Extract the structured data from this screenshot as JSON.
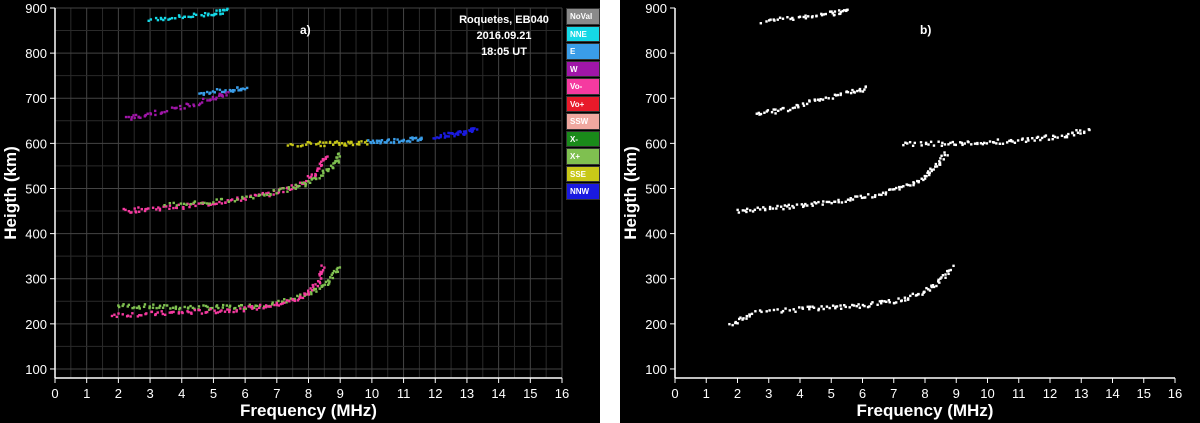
{
  "colors": {
    "background": "#000000",
    "grid": "#3a3a3a",
    "axis": "#ffffff"
  },
  "panel_a": {
    "label": "a)",
    "station": "Roquetes, EB040",
    "date": "2016.09.21",
    "time": "18:05 UT",
    "legend": [
      {
        "name": "NoVal",
        "color": "#8a8a8a"
      },
      {
        "name": "NNE",
        "color": "#15d8e6"
      },
      {
        "name": "E",
        "color": "#3a9de8"
      },
      {
        "name": "W",
        "color": "#a016a8"
      },
      {
        "name": "Vo-",
        "color": "#f53aa0"
      },
      {
        "name": "Vo+",
        "color": "#e81a2a"
      },
      {
        "name": "SSW",
        "color": "#f0a8a0"
      },
      {
        "name": "X-",
        "color": "#1a8a1a"
      },
      {
        "name": "X+",
        "color": "#7fc050"
      },
      {
        "name": "SSE",
        "color": "#c8c818"
      },
      {
        "name": "NNW",
        "color": "#1a1ae0"
      }
    ]
  },
  "panel_b": {
    "label": "b)"
  },
  "chart_data": [
    {
      "type": "scatter",
      "title": "",
      "xlabel": "Frequency (MHz)",
      "ylabel": "Heigth (km)",
      "xlim": [
        0,
        16
      ],
      "ylim": [
        80,
        900
      ],
      "xticks": [
        "0",
        "1",
        "2",
        "3",
        "4",
        "5",
        "6",
        "7",
        "8",
        "9",
        "10",
        "11",
        "12",
        "13",
        "14",
        "15",
        "16"
      ],
      "yticks": [
        "100",
        "200",
        "300",
        "400",
        "500",
        "600",
        "700",
        "800",
        "900"
      ],
      "grid": true,
      "series": [
        {
          "name": "X+",
          "color": "#7fc050",
          "points": [
            [
              2.0,
              240
            ],
            [
              3,
              238
            ],
            [
              4,
              236
            ],
            [
              5,
              236
            ],
            [
              6,
              238
            ],
            [
              7,
              245
            ],
            [
              8,
              265
            ],
            [
              8.6,
              290
            ],
            [
              9.0,
              330
            ]
          ]
        },
        {
          "name": "Vo-",
          "color": "#f53aa0",
          "points": [
            [
              1.8,
              220
            ],
            [
              3,
              222
            ],
            [
              4,
              225
            ],
            [
              5,
              228
            ],
            [
              6,
              233
            ],
            [
              7,
              242
            ],
            [
              7.8,
              258
            ],
            [
              8.3,
              290
            ],
            [
              8.5,
              330
            ]
          ]
        },
        {
          "name": "Vo-",
          "color": "#f53aa0",
          "points": [
            [
              2.2,
              450
            ],
            [
              3,
              455
            ],
            [
              4,
              460
            ],
            [
              5,
              468
            ],
            [
              6,
              478
            ],
            [
              7,
              492
            ],
            [
              7.8,
              510
            ],
            [
              8.3,
              540
            ],
            [
              8.6,
              575
            ]
          ]
        },
        {
          "name": "X+",
          "color": "#7fc050",
          "points": [
            [
              3.5,
              465
            ],
            [
              5,
              470
            ],
            [
              6.5,
              485
            ],
            [
              7.5,
              500
            ],
            [
              8.2,
              520
            ],
            [
              8.8,
              550
            ],
            [
              9.0,
              575
            ]
          ]
        },
        {
          "name": "SSE",
          "color": "#c8c818",
          "points": [
            [
              7.4,
              598
            ],
            [
              8.5,
              599
            ],
            [
              9.2,
              600
            ],
            [
              9.9,
              602
            ]
          ]
        },
        {
          "name": "E",
          "color": "#3a9de8",
          "points": [
            [
              9.9,
              603
            ],
            [
              10.5,
              605
            ],
            [
              11.2,
              608
            ],
            [
              11.6,
              610
            ]
          ]
        },
        {
          "name": "NNW",
          "color": "#1a1ae0",
          "points": [
            [
              12.0,
              615
            ],
            [
              12.5,
              620
            ],
            [
              13.0,
              625
            ],
            [
              13.3,
              632
            ]
          ]
        },
        {
          "name": "W",
          "color": "#a016a8",
          "points": [
            [
              2.3,
              655
            ],
            [
              3,
              665
            ],
            [
              4,
              680
            ],
            [
              5,
              700
            ],
            [
              5.5,
              712
            ]
          ]
        },
        {
          "name": "E",
          "color": "#3a9de8",
          "points": [
            [
              4.5,
              712
            ],
            [
              5.5,
              718
            ],
            [
              6.1,
              720
            ]
          ]
        },
        {
          "name": "NNE",
          "color": "#15d8e6",
          "points": [
            [
              3,
              875
            ],
            [
              4,
              880
            ],
            [
              5,
              888
            ],
            [
              5.5,
              895
            ]
          ]
        }
      ]
    },
    {
      "type": "scatter",
      "title": "",
      "xlabel": "Frequency (MHz)",
      "ylabel": "Heigth (km)",
      "xlim": [
        0,
        16
      ],
      "ylim": [
        80,
        900
      ],
      "xticks": [
        "0",
        "1",
        "2",
        "3",
        "4",
        "5",
        "6",
        "7",
        "8",
        "9",
        "10",
        "11",
        "12",
        "13",
        "14",
        "15",
        "16"
      ],
      "yticks": [
        "100",
        "200",
        "300",
        "400",
        "500",
        "600",
        "700",
        "800",
        "900"
      ],
      "grid": false,
      "series": [
        {
          "color": "#ffffff",
          "points": [
            [
              1.8,
              200
            ],
            [
              2.5,
              225
            ],
            [
              4,
              232
            ],
            [
              5,
              236
            ],
            [
              6,
              240
            ],
            [
              7,
              250
            ],
            [
              7.8,
              265
            ],
            [
              8.4,
              290
            ],
            [
              8.9,
              330
            ]
          ]
        },
        {
          "color": "#ffffff",
          "points": [
            [
              2.0,
              448
            ],
            [
              3,
              455
            ],
            [
              4,
              462
            ],
            [
              5,
              470
            ],
            [
              6,
              480
            ],
            [
              7,
              495
            ],
            [
              7.8,
              515
            ],
            [
              8.3,
              545
            ],
            [
              8.7,
              580
            ]
          ]
        },
        {
          "color": "#ffffff",
          "points": [
            [
              7.3,
              598
            ],
            [
              8.5,
              599
            ],
            [
              9.5,
              601
            ],
            [
              10.5,
              604
            ],
            [
              11.5,
              609
            ],
            [
              12.5,
              617
            ],
            [
              13.3,
              632
            ]
          ]
        },
        {
          "color": "#ffffff",
          "points": [
            [
              2.6,
              665
            ],
            [
              3.5,
              675
            ],
            [
              4.5,
              695
            ],
            [
              5.5,
              712
            ],
            [
              6.2,
              722
            ]
          ]
        },
        {
          "color": "#ffffff",
          "points": [
            [
              2.8,
              870
            ],
            [
              4,
              880
            ],
            [
              5,
              888
            ],
            [
              5.6,
              895
            ]
          ]
        }
      ]
    }
  ]
}
